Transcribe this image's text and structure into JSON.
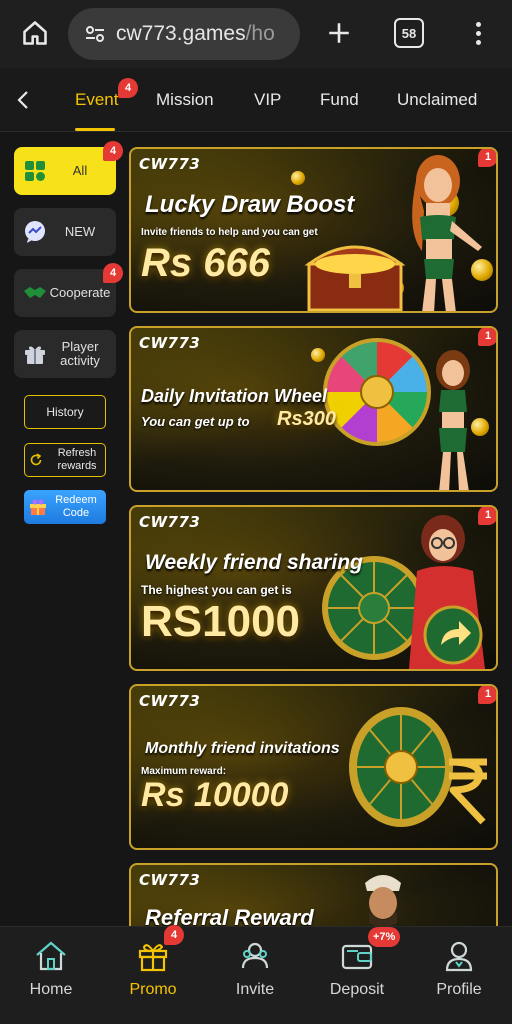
{
  "browser": {
    "url_main": "cw773.games",
    "url_tail": "/ho",
    "tab_count": "58"
  },
  "tabs": [
    {
      "label": "Event",
      "active": true,
      "badge": "4"
    },
    {
      "label": "Mission"
    },
    {
      "label": "VIP"
    },
    {
      "label": "Fund"
    },
    {
      "label": "Unclaimed"
    }
  ],
  "sidebar": {
    "items": [
      {
        "label": "All",
        "badge": "4",
        "icon": "grid-icon"
      },
      {
        "label": "NEW",
        "icon": "chat-icon"
      },
      {
        "label": "Cooperate",
        "badge": "4",
        "icon": "handshake-icon"
      },
      {
        "label": "Player activity",
        "icon": "gift-icon"
      }
    ],
    "history_label": "History",
    "refresh_label": "Refresh rewards",
    "redeem_label": "Redeem Code"
  },
  "banners": [
    {
      "brand": "CW773",
      "title": "Lucky Draw Boost",
      "subtitle": "Invite friends to help and you can get",
      "amount": "Rs 666",
      "badge": "1"
    },
    {
      "brand": "CW773",
      "title": "Daily Invitation Wheel",
      "subtitle": "You can get up to",
      "amount": "Rs300",
      "badge": "1"
    },
    {
      "brand": "CW773",
      "title": "Weekly friend sharing",
      "subtitle": "The highest you can get is",
      "amount": "RS1000",
      "badge": "1"
    },
    {
      "brand": "CW773",
      "title": "Monthly friend invitations",
      "subtitle": "Maximum reward:",
      "amount": "Rs 10000",
      "badge": "1"
    },
    {
      "brand": "CW773",
      "title": "Referral Reward"
    }
  ],
  "bottom_nav": [
    {
      "label": "Home",
      "icon": "home-icon"
    },
    {
      "label": "Promo",
      "icon": "gift-icon",
      "badge": "4",
      "active": true
    },
    {
      "label": "Invite",
      "icon": "invite-icon"
    },
    {
      "label": "Deposit",
      "icon": "wallet-icon",
      "badge": "+7%"
    },
    {
      "label": "Profile",
      "icon": "profile-icon"
    }
  ],
  "colors": {
    "accent": "#f5c400",
    "badge": "#e53935",
    "active_sidebar": "#f7e21a",
    "card_border": "#c9a128"
  }
}
